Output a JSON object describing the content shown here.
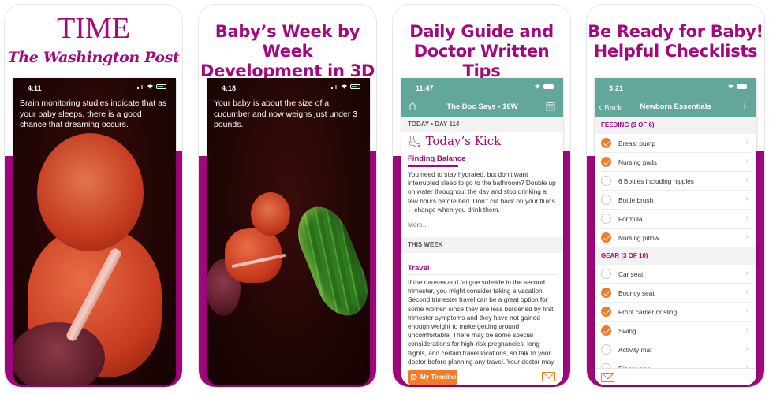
{
  "colors": {
    "brand_purple": "#a3087f",
    "teal": "#63a69a",
    "orange": "#f07c2a"
  },
  "panels": [
    {
      "logos": {
        "time": "TIME",
        "washington_post": "The Washington Post"
      },
      "status": {
        "clock": "4:11"
      },
      "caption": "Brain monitoring studies indicate that as your baby sleeps, there is a good chance that dreaming occurs."
    },
    {
      "headline_line1": "Baby’s Week by Week",
      "headline_line2": "Development in 3D",
      "status": {
        "clock": "4:18"
      },
      "caption": "Your baby is about the size of a cucumber and now weighs just under 3 pounds."
    },
    {
      "headline_line1": "Daily Guide and",
      "headline_line2": "Doctor Written Tips",
      "status": {
        "clock": "11:47"
      },
      "nav": {
        "title": "The Doc Says • 16W",
        "left_icon": "home-icon",
        "right_icon": "calendar-icon"
      },
      "today_label": "TODAY • DAY 114",
      "kick_title": "Today’s Kick",
      "finding_title": "Finding Balance",
      "finding_text": "You need to stay hydrated, but don’t want interrupted sleep to go to the bathroom? Double up on water throughout the day and stop drinking a few hours before bed. Don’t cut back on your fluids—change when you drink them.",
      "more_label": "More...",
      "this_week_label": "THIS WEEK",
      "travel_title": "Travel",
      "travel_text": "If the nausea and fatigue subside in the second trimester, you might consider taking a vacation. Second trimester travel can be a great option for some women since they are less burdened by first trimester symptoms and they have not gained enough weight to make getting around uncomfortable. There may be some special considerations for high-risk pregnancies, long flights, and certain travel locations, so talk to your doctor before planning any travel. Your doctor may suggest ambulating frequently during long flights to help reduce the risk of blood clots. It is",
      "timeline_button": "My Timeline"
    },
    {
      "headline_line1": "Be Ready for Baby!",
      "headline_line2": "Helpful Checklists",
      "status": {
        "clock": "3:21"
      },
      "nav": {
        "back_label": "Back",
        "title": "Newborn Essentials",
        "add_label": "+"
      },
      "sections": [
        {
          "title": "FEEDING (3 OF 6)",
          "items": [
            {
              "label": "Breast pump",
              "checked": true
            },
            {
              "label": "Nursing pads",
              "checked": true
            },
            {
              "label": "6 Bottles including nipples",
              "checked": false
            },
            {
              "label": "Bottle brush",
              "checked": false
            },
            {
              "label": "Formula",
              "checked": false
            },
            {
              "label": "Nursing pillow",
              "checked": true
            }
          ]
        },
        {
          "title": "GEAR (3 OF 10)",
          "items": [
            {
              "label": "Car seat",
              "checked": false
            },
            {
              "label": "Bouncy seat",
              "checked": true
            },
            {
              "label": "Front carrier or sling",
              "checked": true
            },
            {
              "label": "Swing",
              "checked": true
            },
            {
              "label": "Activity mat",
              "checked": false
            },
            {
              "label": "Diaper bag",
              "checked": false
            }
          ]
        }
      ]
    }
  ]
}
